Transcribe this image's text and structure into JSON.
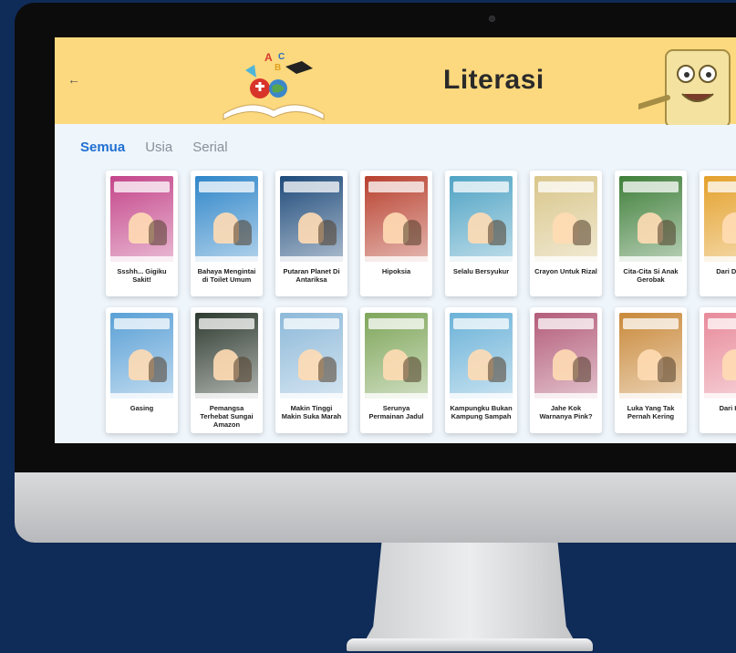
{
  "header": {
    "title": "Literasi",
    "back_icon": "arrow-left-icon"
  },
  "tabs": [
    {
      "label": "Semua",
      "active": true
    },
    {
      "label": "Usia",
      "active": false
    },
    {
      "label": "Serial",
      "active": false
    }
  ],
  "books_row1": [
    {
      "title": "Ssshh... Gigiku Sakit!",
      "color": "#c4458a"
    },
    {
      "title": "Bahaya Mengintai di Toilet Umum",
      "color": "#2f86c9"
    },
    {
      "title": "Putaran Planet Di Antariksa",
      "color": "#1e4a7a"
    },
    {
      "title": "Hipoksia",
      "color": "#b8402e"
    },
    {
      "title": "Selalu Bersyukur",
      "color": "#4fa3c4"
    },
    {
      "title": "Crayon Untuk Rizal",
      "color": "#d9c68a"
    },
    {
      "title": "Cita-Cita Si Anak Gerobak",
      "color": "#3f7f3a"
    },
    {
      "title": "Dari Data Fr",
      "color": "#e4a12b"
    }
  ],
  "books_row2": [
    {
      "title": "Gasing",
      "color": "#5aa0d6"
    },
    {
      "title": "Pemangsa Terhebat Sungai Amazon",
      "color": "#2e3a2f"
    },
    {
      "title": "Makin Tinggi Makin Suka Marah",
      "color": "#8db9d9"
    },
    {
      "title": "Serunya Permainan Jadul",
      "color": "#7fa65a"
    },
    {
      "title": "Kampungku Bukan Kampung Sampah",
      "color": "#6bb2d8"
    },
    {
      "title": "Jahe Kok Warnanya Pink?",
      "color": "#b35c7a"
    },
    {
      "title": "Luka Yang Tak Pernah Kering",
      "color": "#c9893a"
    },
    {
      "title": "Dari Hi Ke",
      "color": "#e88a9a"
    }
  ]
}
